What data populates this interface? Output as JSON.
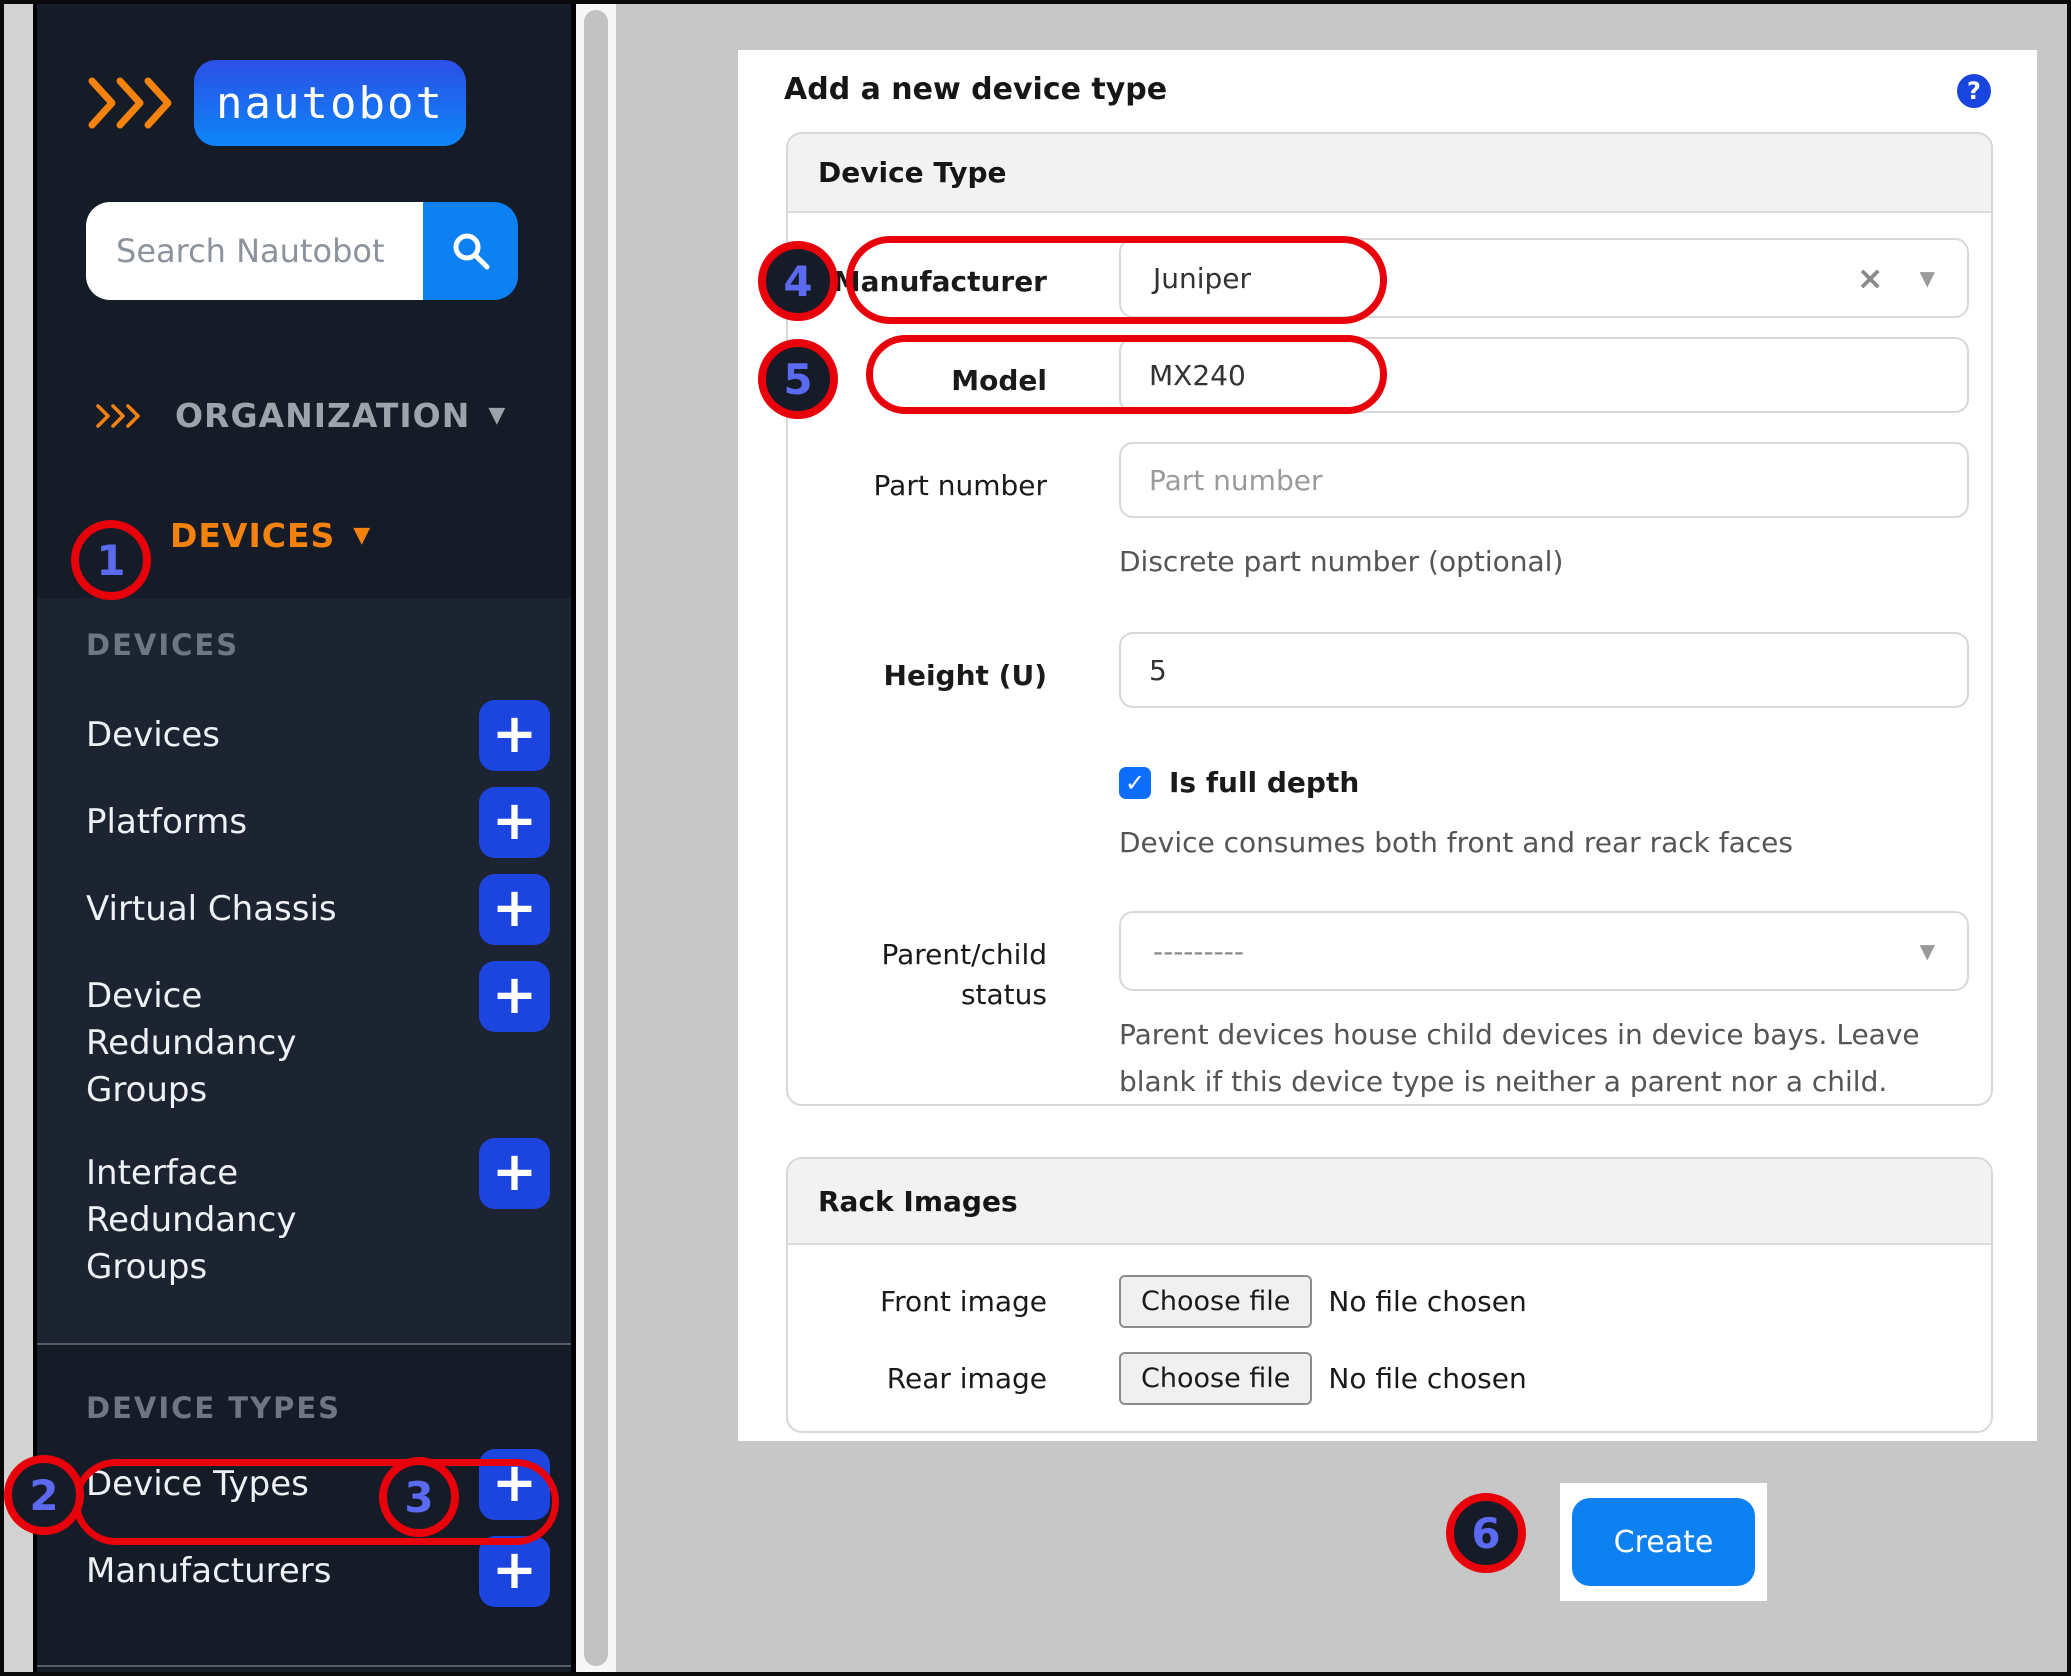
{
  "sidebar": {
    "logo_text": "nautobot",
    "search_placeholder": "Search Nautobot",
    "nav": {
      "organization": "ORGANIZATION",
      "devices": "DEVICES"
    },
    "devices_section": {
      "header": "DEVICES",
      "items": [
        "Devices",
        "Platforms",
        "Virtual Chassis",
        "Device Redundancy Groups",
        "Interface Redundancy Groups"
      ]
    },
    "device_types_section": {
      "header": "DEVICE TYPES",
      "items": [
        "Device Types",
        "Manufacturers"
      ]
    }
  },
  "page": {
    "title": "Add a new device type"
  },
  "device_type_panel": {
    "header": "Device Type",
    "manufacturer": {
      "label": "Manufacturer",
      "value": "Juniper"
    },
    "model": {
      "label": "Model",
      "value": "MX240"
    },
    "part_number": {
      "label": "Part number",
      "placeholder": "Part number",
      "help": "Discrete part number (optional)"
    },
    "height_u": {
      "label": "Height (U)",
      "value": "5"
    },
    "is_full_depth": {
      "label": "Is full depth",
      "checked": true,
      "help": "Device consumes both front and rear rack faces"
    },
    "parent_child": {
      "label": "Parent/child status",
      "value": "---------",
      "help": "Parent devices house child devices in device bays. Leave blank if this device type is neither a parent nor a child."
    }
  },
  "rack_images_panel": {
    "header": "Rack Images",
    "front": {
      "label": "Front image",
      "button": "Choose file",
      "status": "No file chosen"
    },
    "rear": {
      "label": "Rear image",
      "button": "Choose file",
      "status": "No file chosen"
    }
  },
  "actions": {
    "create": "Create"
  },
  "annotations": {
    "steps": [
      "1",
      "2",
      "3",
      "4",
      "5",
      "6"
    ]
  },
  "icons": {
    "plus": "+",
    "help": "?",
    "clear": "×",
    "caret_down": "▼",
    "check": "✓"
  },
  "colors": {
    "accent_blue": "#1c45e0",
    "azure_blue": "#0d80f2",
    "orange": "#f5820d",
    "annotation_red": "#e8000b",
    "sidebar_dark": "#151c28"
  }
}
